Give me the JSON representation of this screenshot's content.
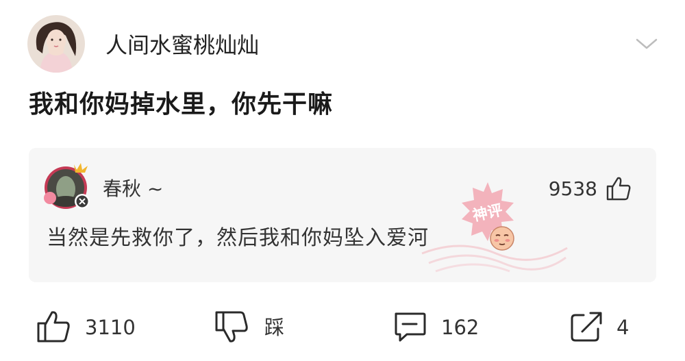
{
  "post": {
    "username": "人间水蜜桃灿灿",
    "text": "我和你妈掉水里，你先干嘛"
  },
  "hot_comment": {
    "username": "春秋 ~",
    "likes": "9538",
    "text": "当然是先救你了，然后我和你妈坠入爱河",
    "stamp_text": "神评",
    "emoji_icon": "blush-face-emoji"
  },
  "actions": {
    "like_count": "3110",
    "dislike_label": "踩",
    "comment_count": "162",
    "share_count": "4"
  },
  "colors": {
    "card_bg": "#f6f6f6",
    "stamp_pink": "#f0a3ae"
  }
}
